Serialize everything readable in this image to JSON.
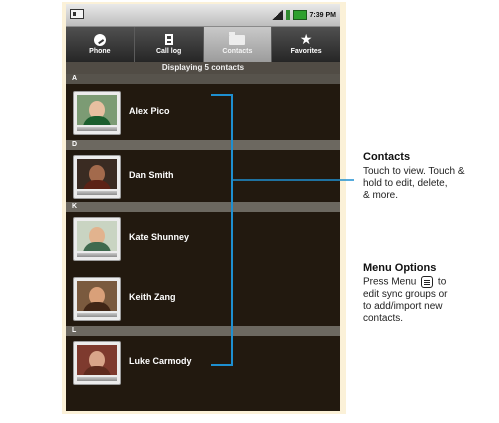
{
  "status_bar": {
    "time": "7:39 PM",
    "icons": [
      "sd-card-icon",
      "signal-icon",
      "data-icon",
      "battery-icon"
    ]
  },
  "tabs": [
    {
      "label": "Phone",
      "icon": "phone-icon"
    },
    {
      "label": "Call log",
      "icon": "call-log-icon"
    },
    {
      "label": "Contacts",
      "icon": "contacts-folder-icon",
      "active": true
    },
    {
      "label": "Favorites",
      "icon": "star-icon"
    }
  ],
  "list_header": "Displaying 5 contacts",
  "sections": [
    "A",
    "D",
    "K",
    "L"
  ],
  "contacts": [
    {
      "name": "Alex Pico",
      "section": "A"
    },
    {
      "name": "Dan Smith",
      "section": "D"
    },
    {
      "name": "Kate Shunney",
      "section": "K"
    },
    {
      "name": "Keith Zang",
      "section": "K"
    },
    {
      "name": "Luke Carmody",
      "section": "L"
    }
  ],
  "callouts": {
    "contacts": {
      "title": "Contacts",
      "lines": [
        "Touch to view. Touch &",
        "hold to edit, delete,",
        "& more."
      ]
    },
    "menu_options": {
      "title": "Menu Options",
      "line1_before": "Press Menu",
      "line1_after": "to",
      "lines": [
        "edit sync groups or",
        "to add/import new",
        "contacts."
      ]
    }
  },
  "colors": {
    "accent_line": "#1e8fd0",
    "list_background": "#22190f",
    "frame_background": "#fbf1d8"
  }
}
